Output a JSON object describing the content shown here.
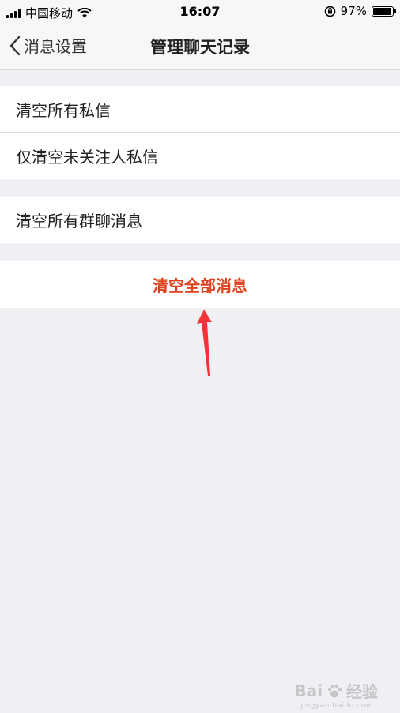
{
  "status_bar": {
    "carrier": "中国移动",
    "time": "16:07",
    "battery_percent": "97%",
    "battery_level": 0.97,
    "icons": [
      "signal-icon",
      "wifi-icon",
      "orientation-lock-icon",
      "battery-icon"
    ]
  },
  "nav": {
    "back_label": "消息设置",
    "title": "管理聊天记录"
  },
  "sections": {
    "private": {
      "items": [
        {
          "label": "清空所有私信"
        },
        {
          "label": "仅清空未关注人私信"
        }
      ]
    },
    "group": {
      "items": [
        {
          "label": "清空所有群聊消息"
        }
      ]
    },
    "danger": {
      "label": "清空全部消息",
      "color": "#e0411c"
    }
  },
  "annotation": {
    "arrow_color": "#f2333a"
  },
  "watermark": {
    "brand": "Bai",
    "brand_suffix": "经验",
    "url": "jingyan.baidu.com"
  },
  "colors": {
    "background": "#efeff4",
    "cell": "#ffffff"
  }
}
